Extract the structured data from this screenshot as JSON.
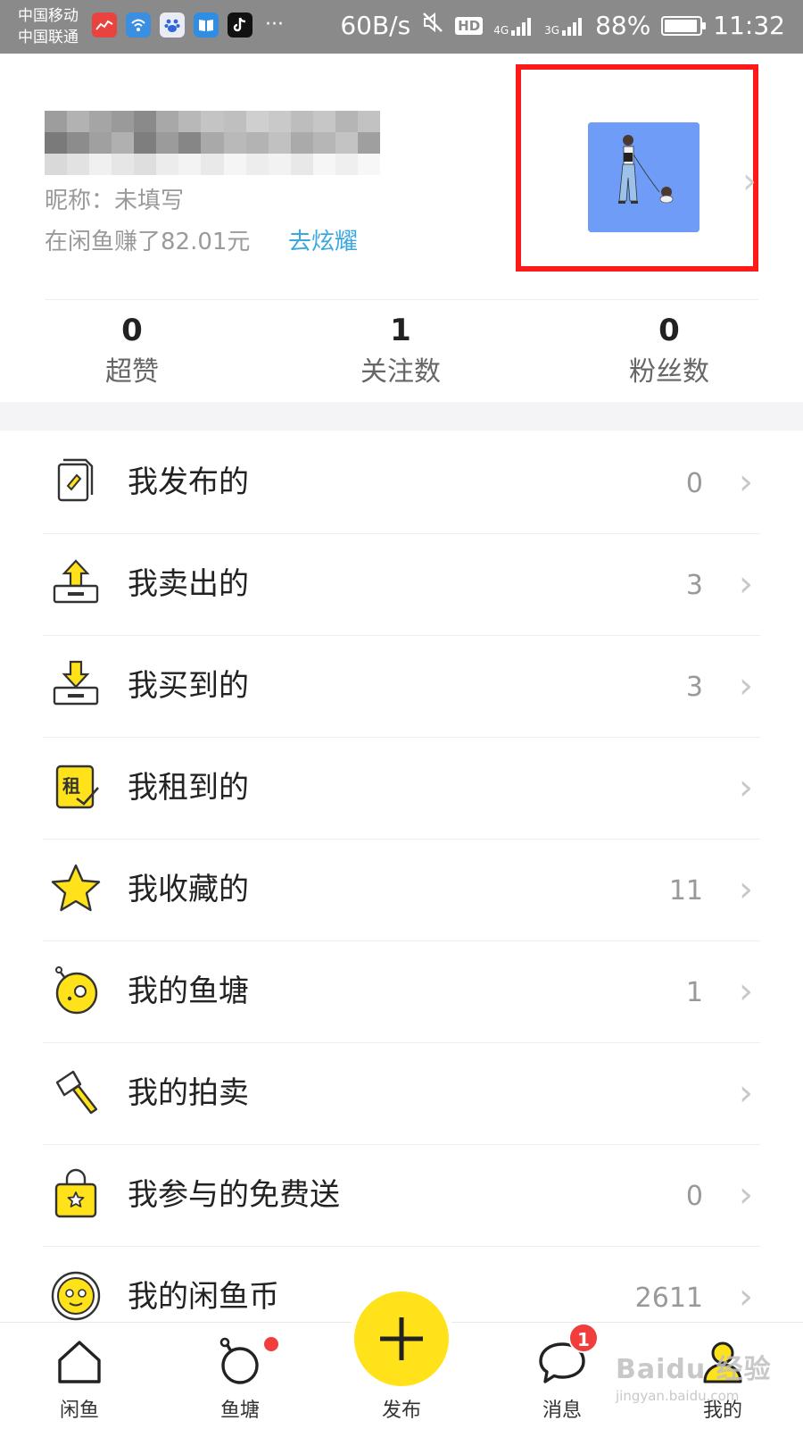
{
  "status_bar": {
    "carrier_1": "中国移动",
    "carrier_2": "中国联通",
    "net_speed": "60B/s",
    "signal_1": "4G",
    "signal_2": "3G",
    "battery": "88%",
    "time": "11:32",
    "icons": [
      "chart-app-icon",
      "wifi-app-icon",
      "baidu-app-icon",
      "book-app-icon",
      "tiktok-app-icon"
    ],
    "more": "···",
    "hd": "HD"
  },
  "profile": {
    "nickname": "昵称：未填写",
    "earned": "在闲鱼赚了82.01元",
    "showoff": "去炫耀",
    "highlight_color": "#ff1a1a",
    "avatar_bg": "#6e9cf7"
  },
  "stats": [
    {
      "value": "0",
      "label": "超赞"
    },
    {
      "value": "1",
      "label": "关注数"
    },
    {
      "value": "0",
      "label": "粉丝数"
    }
  ],
  "menu": [
    {
      "label": "我发布的",
      "count": "0",
      "icon": "document-edit-icon"
    },
    {
      "label": "我卖出的",
      "count": "3",
      "icon": "box-upload-icon"
    },
    {
      "label": "我买到的",
      "count": "3",
      "icon": "box-download-icon"
    },
    {
      "label": "我租到的",
      "count": "",
      "icon": "rent-icon",
      "icon_text": "租"
    },
    {
      "label": "我收藏的",
      "count": "11",
      "icon": "star-icon"
    },
    {
      "label": "我的鱼塘",
      "count": "1",
      "icon": "fish-pond-icon"
    },
    {
      "label": "我的拍卖",
      "count": "",
      "icon": "auction-hammer-icon"
    },
    {
      "label": "我参与的免费送",
      "count": "0",
      "icon": "gift-bag-icon"
    },
    {
      "label": "我的闲鱼币",
      "count": "2611",
      "icon": "coin-icon"
    }
  ],
  "bottom_nav": [
    {
      "label": "闲鱼",
      "icon": "home-icon"
    },
    {
      "label": "鱼塘",
      "icon": "pond-ring-icon"
    },
    {
      "label": "发布",
      "icon": "plus-icon"
    },
    {
      "label": "消息",
      "icon": "chat-bubble-icon",
      "badge": "1"
    },
    {
      "label": "我的",
      "icon": "user-icon"
    }
  ],
  "watermark": {
    "line1": "Baidu 经验",
    "line2": "jingyan.baidu.com"
  },
  "colors": {
    "accent_yellow": "#ffe21a",
    "link_blue": "#3ba7e0",
    "badge_red": "#f23d3d"
  }
}
